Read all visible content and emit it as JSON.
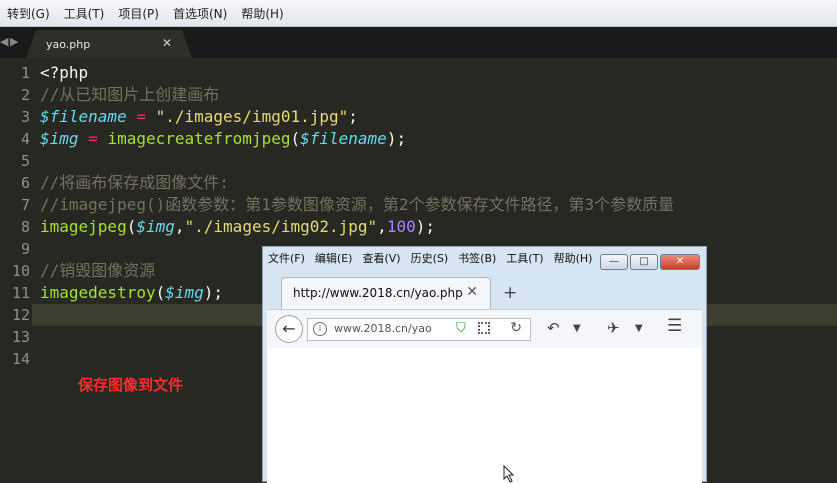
{
  "menu": [
    "转到(G)",
    "工具(T)",
    "项目(P)",
    "首选项(N)",
    "帮助(H)"
  ],
  "editor": {
    "tab_title": "yao.php",
    "line_numbers": [
      "1",
      "2",
      "3",
      "4",
      "5",
      "6",
      "7",
      "8",
      "9",
      "10",
      "11",
      "12",
      "13",
      "14"
    ],
    "lines": {
      "l1": "<?php",
      "l2": "//从已知图片上创建画布",
      "l3_var": "$filename",
      "l3_op": " = ",
      "l3_str": "\"./images/img01.jpg\"",
      "l3_end": ";",
      "l4_var": "$img",
      "l4_op": " = ",
      "l4_fn": "imagecreatefromjpeg",
      "l4_p1": "(",
      "l4_arg": "$filename",
      "l4_p2": ");",
      "l6": "//将画布保存成图像文件:",
      "l7": "//imagejpeg()函数参数：第1参数图像资源，第2个参数保存文件路径，第3个参数质量",
      "l8_fn": "imagejpeg",
      "l8_p1": "(",
      "l8_var": "$img",
      "l8_c1": ",",
      "l8_str": "\"./images/img02.jpg\"",
      "l8_c2": ",",
      "l8_num": "100",
      "l8_p2": ");",
      "l10": "//销毁图像资源",
      "l11_fn": "imagedestroy",
      "l11_p1": "(",
      "l11_var": "$img",
      "l11_p2": ");"
    },
    "caption": "保存图像到文件"
  },
  "browser": {
    "menu": [
      "文件(F)",
      "编辑(E)",
      "查看(V)",
      "历史(S)",
      "书签(B)",
      "工具(T)",
      "帮助(H)"
    ],
    "tab_title": "http://www.2018.cn/yao.php",
    "url_text": "www.2018.cn/yao",
    "icons": [
      "back-arrow-icon",
      "info-icon",
      "shield-icon",
      "qr-icon",
      "reload-icon",
      "undo-icon",
      "dropdown-icon",
      "extension-icon",
      "hamburger-menu-icon"
    ]
  }
}
